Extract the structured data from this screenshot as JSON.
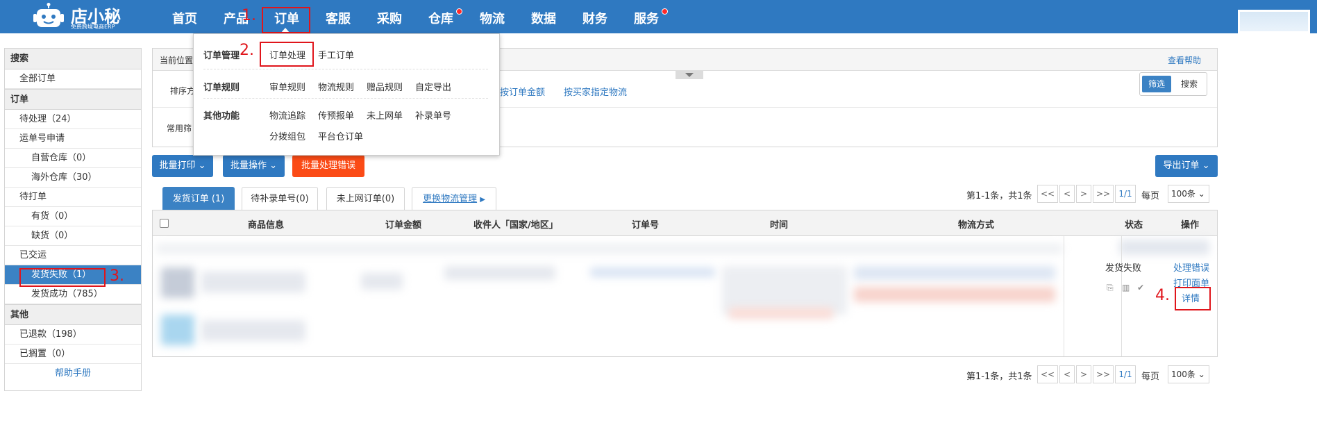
{
  "brand": {
    "name": "店小秘",
    "tagline": "免费跨境电商ERP"
  },
  "nav": [
    {
      "label": "首页"
    },
    {
      "label": "产品"
    },
    {
      "label": "订单"
    },
    {
      "label": "客服"
    },
    {
      "label": "采购"
    },
    {
      "label": "仓库"
    },
    {
      "label": "物流"
    },
    {
      "label": "数据"
    },
    {
      "label": "财务"
    },
    {
      "label": "服务"
    }
  ],
  "annotations": [
    "1.",
    "2.",
    "3.",
    "4."
  ],
  "menu": {
    "sections": [
      {
        "title": "订单管理",
        "items": [
          "订单处理",
          "手工订单"
        ]
      },
      {
        "title": "订单规则",
        "items": [
          "审单规则",
          "物流规则",
          "赠品规则",
          "自定导出"
        ]
      },
      {
        "title": "其他功能",
        "items": [
          "物流追踪",
          "传预报单",
          "未上网单",
          "补录单号",
          "分拨组包",
          "平台仓订单"
        ]
      }
    ]
  },
  "sidebar": {
    "search_header": "搜索",
    "all_orders": "全部订单",
    "orders_header": "订单",
    "items": [
      {
        "label": "待处理",
        "count": "（24）"
      },
      {
        "label": "运单号申请",
        "count": ""
      },
      {
        "label": "自营仓库",
        "count": "（0）"
      },
      {
        "label": "海外仓库",
        "count": "（30）"
      },
      {
        "label": "待打单",
        "count": ""
      },
      {
        "label": "有货",
        "count": "（0）"
      },
      {
        "label": "缺货",
        "count": "（0）"
      },
      {
        "label": "已交运",
        "count": ""
      },
      {
        "label": "发货失败",
        "count": "（1）"
      },
      {
        "label": "发货成功",
        "count": "（785）"
      }
    ],
    "other_header": "其他",
    "other_items": [
      {
        "label": "已退款",
        "count": "（198）"
      },
      {
        "label": "已搁置",
        "count": "（0）"
      }
    ],
    "help": "帮助手册"
  },
  "panel": {
    "location_label": "当前位置",
    "help_link": "查看帮助",
    "sort_label": "排序方",
    "sort_links": [
      "按订单金额",
      "按买家指定物流"
    ],
    "common_label": "常用筛",
    "filter_toggle": [
      "筛选",
      "搜索"
    ]
  },
  "toolbar": {
    "batch_print": "批量打印",
    "batch_ops": "批量操作",
    "batch_errors": "批量处理错误",
    "export": "导出订单"
  },
  "tabs": [
    {
      "label": "发货订单 (1)"
    },
    {
      "label": "待补录单号(0)"
    },
    {
      "label": "未上网订单(0)"
    },
    {
      "label": "更换物流管理"
    }
  ],
  "pager": {
    "summary": "第1-1条，共1条",
    "first": "<<",
    "prev": "<",
    "next": ">",
    "last": ">>",
    "page": "1/1",
    "per_page_label": "每页",
    "per_page": "100条"
  },
  "table": {
    "headers": [
      "商品信息",
      "订单金额",
      "收件人「国家/地区」",
      "订单号",
      "时间",
      "物流方式",
      "状态",
      "操作"
    ],
    "row": {
      "status": "发货失败",
      "actions": [
        "处理错误",
        "打印面单",
        "详情"
      ]
    }
  }
}
